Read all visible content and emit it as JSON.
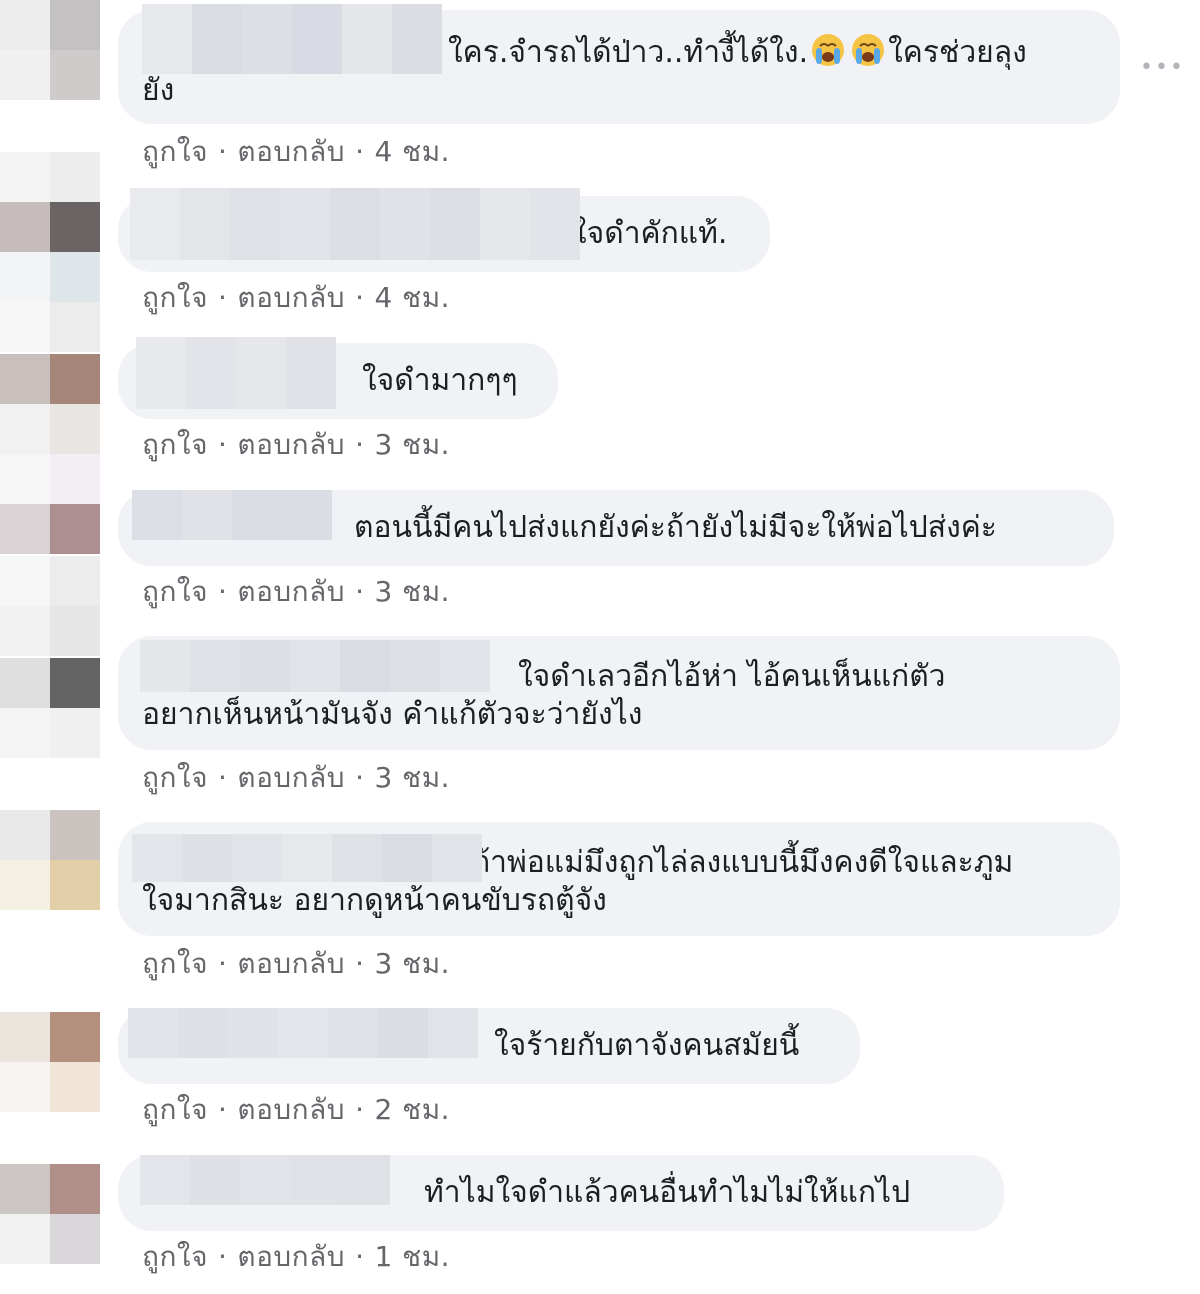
{
  "ui": {
    "more_label": "•••",
    "colors": {
      "bubble_bg": "#f0f2f5",
      "meta_text": "#65676b",
      "text": "#1c1e21"
    }
  },
  "comments": [
    {
      "text_a": "ใคร.จำรถได้ป่าว..ทำงี้ได้ใง.",
      "text_b": "ใครช่วยลุง",
      "text_c": "ยัง",
      "emoji": [
        "loudly-crying-face",
        "loudly-crying-face"
      ],
      "like": "ถูกใจ",
      "reply": "ตอบกลับ",
      "time": "4 ชม."
    },
    {
      "text_a": "ใจดำคักแท้.",
      "like": "ถูกใจ",
      "reply": "ตอบกลับ",
      "time": "4 ชม."
    },
    {
      "text_a": "ใจดำมากๆๆ",
      "like": "ถูกใจ",
      "reply": "ตอบกลับ",
      "time": "3 ชม."
    },
    {
      "text_a": "ตอนนี้มีคนไปส่งแกยังค่ะถ้ายังไม่มีจะให้พ่อไปส่งค่ะ",
      "like": "ถูกใจ",
      "reply": "ตอบกลับ",
      "time": "3 ชม."
    },
    {
      "text_a": "ใจดำเลวอีกไอ้ห่า ไอ้คนเห็นแก่ตัว",
      "text_c": "อยากเห็นหน้ามันจัง คำแก้ตัวจะว่ายังไง",
      "like": "ถูกใจ",
      "reply": "ตอบกลับ",
      "time": "3 ชม."
    },
    {
      "text_a": "ถ้าพ่อแม่มึงถูกไล่ลงแบบนี้มึงคงดีใจและภูม",
      "text_c": "ใจมากสินะ อยากดูหน้าคนขับรถตู้จัง",
      "like": "ถูกใจ",
      "reply": "ตอบกลับ",
      "time": "3 ชม."
    },
    {
      "text_a": "ใจร้ายกับตาจังคนสมัยนี้",
      "like": "ถูกใจ",
      "reply": "ตอบกลับ",
      "time": "2 ชม."
    },
    {
      "text_a": "ทำไมใจดำแล้วคนอื่นทำไมไม่ให้แกไป",
      "like": "ถูกใจ",
      "reply": "ตอบกลับ",
      "time": "1 ชม."
    }
  ]
}
